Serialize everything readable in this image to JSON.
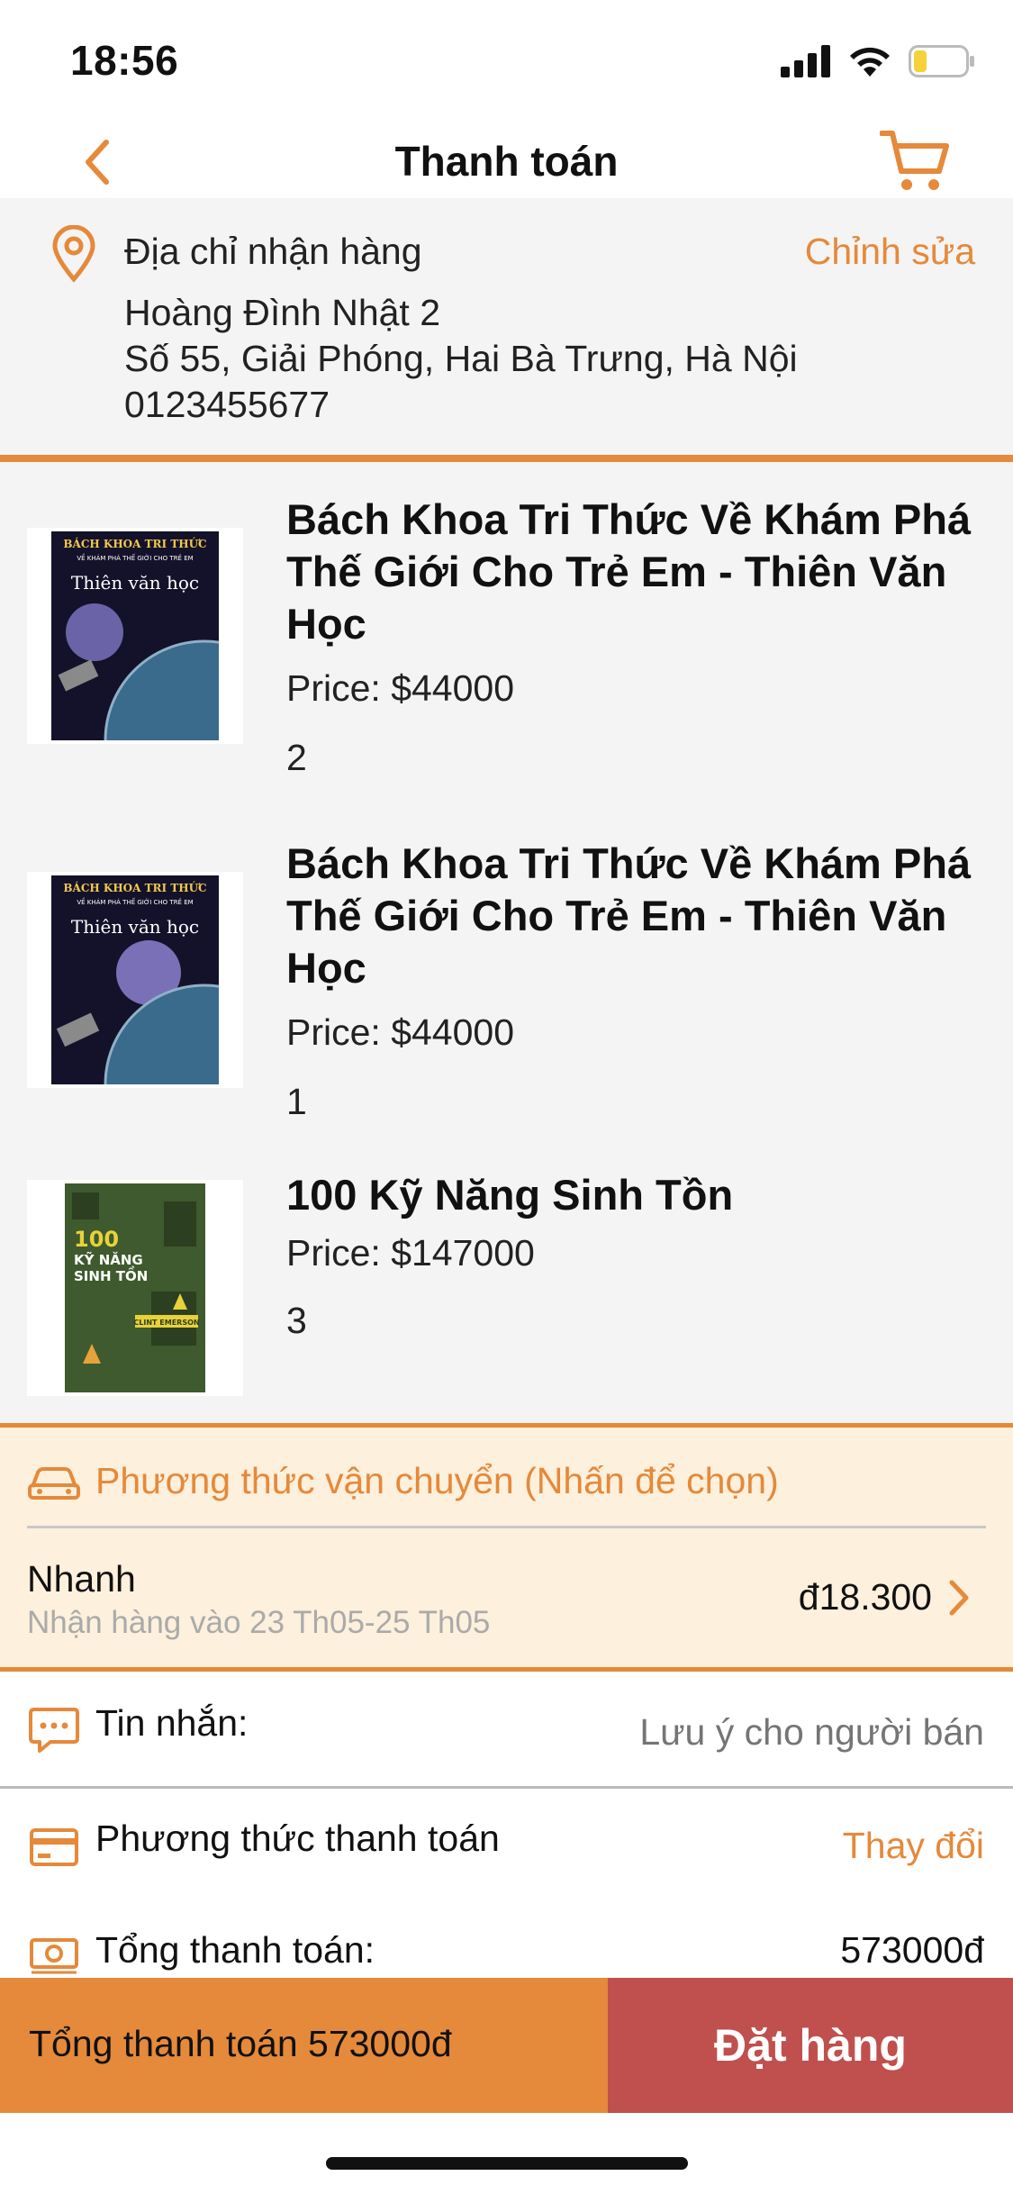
{
  "status_bar": {
    "time": "18:56"
  },
  "nav": {
    "title": "Thanh toán"
  },
  "address": {
    "title": "Địa chỉ nhận hàng",
    "edit_label": "Chỉnh sửa",
    "name": "Hoàng Đình Nhật 2",
    "street": "Số 55, Giải Phóng, Hai Bà Trưng, Hà Nội",
    "phone": "0123455677"
  },
  "products": [
    {
      "title": "Bách Khoa Tri Thức Về Khám Phá Thế Giới Cho Trẻ Em - Thiên Văn Học",
      "price": "Price: $44000",
      "quantity": "2",
      "cover": {
        "header": "BÁCH KHOA TRI THỨC",
        "sub": "VỀ KHÁM PHÁ THẾ GIỚI CHO TRẺ EM",
        "name": "Thiên văn học"
      }
    },
    {
      "title": "Bách Khoa Tri Thức Về Khám Phá Thế Giới Cho Trẻ Em - Thiên Văn Học",
      "price": "Price: $44000",
      "quantity": "1",
      "cover": {
        "header": "BÁCH KHOA TRI THỨC",
        "sub": "VỀ KHÁM PHÁ THẾ GIỚI CHO TRẺ EM",
        "name": "Thiên văn học"
      }
    },
    {
      "title": "100 Kỹ Năng Sinh Tồn",
      "price": "Price: $147000",
      "quantity": "3",
      "cover": {
        "num": "100",
        "name1": "KỸ NĂNG",
        "name2": "SINH TỒN",
        "author": "CLINT EMERSON"
      }
    }
  ],
  "shipping": {
    "title": "Phương thức vận chuyển (Nhấn để chọn)",
    "method": "Nhanh",
    "delivery": "Nhận hàng vào 23 Th05-25 Th05",
    "fee": "đ18.300"
  },
  "message": {
    "label": "Tin nhắn:",
    "placeholder": "Lưu ý cho người bán"
  },
  "payment": {
    "label": "Phương thức thanh toán",
    "change_label": "Thay đổi",
    "total_label": "Tổng thanh toán:",
    "total_value": "573000đ"
  },
  "bottom_bar": {
    "total_text": "Tổng thanh toán 573000đ",
    "order_label": "Đặt hàng"
  },
  "colors": {
    "accent": "#e5893a",
    "order_button": "#c0504d",
    "shipping_bg": "#fdf0dc",
    "section_bg": "#f4f4f4"
  },
  "icons": [
    "back-icon",
    "cart-icon",
    "location-pin-icon",
    "car-icon",
    "chevron-right-icon",
    "chat-icon",
    "credit-card-icon",
    "money-icon"
  ]
}
